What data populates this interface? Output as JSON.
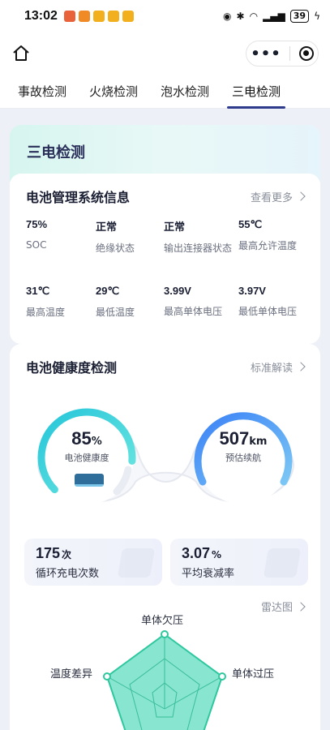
{
  "status_bar": {
    "time": "13:02",
    "battery": "39"
  },
  "tabs": [
    {
      "label": "事故检测"
    },
    {
      "label": "火烧检测"
    },
    {
      "label": "泡水检测"
    },
    {
      "label": "三电检测",
      "active": true
    }
  ],
  "section_title": "三电检测",
  "bms": {
    "title": "电池管理系统信息",
    "more": "查看更多",
    "items": [
      {
        "value": "75%",
        "label": "SOC"
      },
      {
        "value": "正常",
        "label": "绝缘状态"
      },
      {
        "value": "正常",
        "label": "输出连接器状态"
      },
      {
        "value": "55℃",
        "label": "最高允许温度"
      },
      {
        "value": "31℃",
        "label": "最高温度"
      },
      {
        "value": "29℃",
        "label": "最低温度"
      },
      {
        "value": "3.99V",
        "label": "最高单体电压"
      },
      {
        "value": "3.97V",
        "label": "最低单体电压"
      }
    ]
  },
  "health": {
    "title": "电池健康度检测",
    "standard_link": "标准解读",
    "health_gauge": {
      "value": "85",
      "unit": "%",
      "caption": "电池健康度",
      "fraction": 0.85
    },
    "range_gauge": {
      "value": "507",
      "unit": "km",
      "caption": "预估续航"
    },
    "stats": [
      {
        "value": "175",
        "unit": "次",
        "label": "循环充电次数"
      },
      {
        "value": "3.07",
        "unit": "%",
        "label": "平均衰减率"
      }
    ],
    "radar_link": "雷达图",
    "radar_axes": [
      "单体欠压",
      "单体过压",
      "温度差异"
    ]
  },
  "colors": {
    "accent": "#2e3a8c",
    "gauge_teal": "#3fd6e0",
    "gauge_blue": "#4aa3f0",
    "radar_fill": "#5fdcc0"
  }
}
